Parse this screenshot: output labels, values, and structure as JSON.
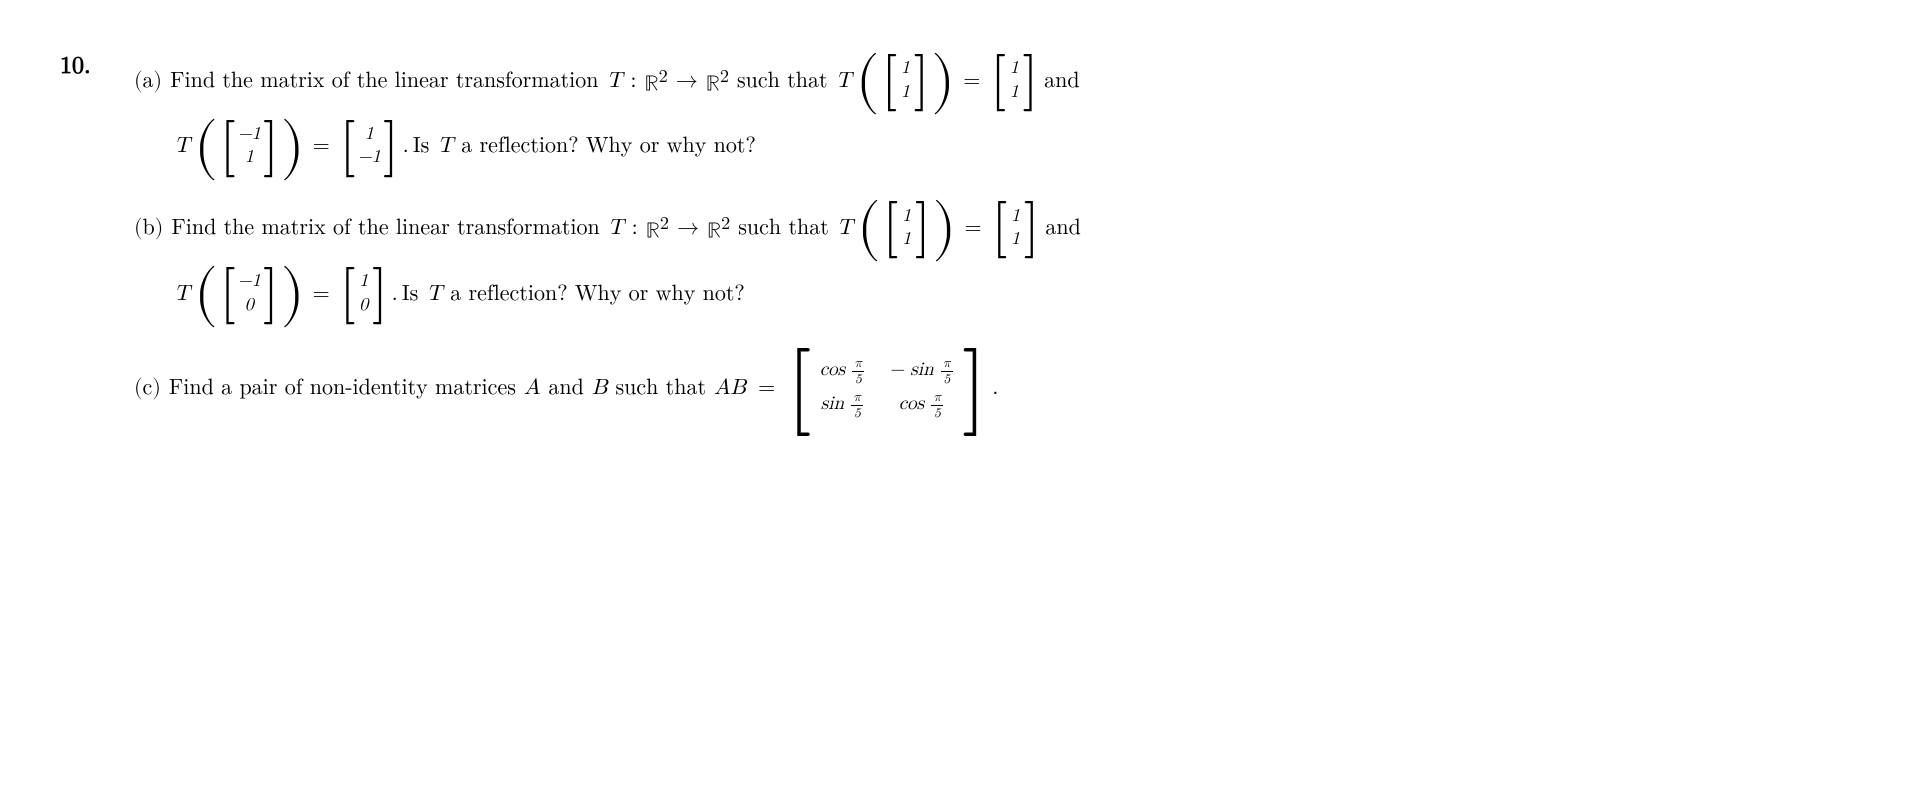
{
  "problem": {
    "number": "10.",
    "parts": {
      "a": {
        "label": "(a)",
        "text1": "Find the matrix of the linear transformation",
        "T": "T",
        "colon": ":",
        "R2": "ℝ",
        "sup1": "2",
        "arrow": "→",
        "R2b": "ℝ",
        "sup2": "2",
        "text2": "such that",
        "T2": "T",
        "input_vec1_top": "1",
        "input_vec1_bot": "1",
        "equals": "=",
        "output_vec1_top": "1",
        "output_vec1_bot": "1",
        "and": "and",
        "T3": "T",
        "input_vec2_top": "−1",
        "input_vec2_bot": "1",
        "equals2": "=",
        "output_vec2_top": "1",
        "output_vec2_bot": "−1",
        "period": ".",
        "question": "Is",
        "T4": "T",
        "question2": "a reflection? Why or why not?"
      },
      "b": {
        "label": "(b)",
        "text1": "Find the matrix of the linear transformation",
        "T": "T",
        "colon": ":",
        "R2": "ℝ",
        "sup1": "2",
        "arrow": "→",
        "R2b": "ℝ",
        "sup2": "2",
        "text2": "such that",
        "T2": "T",
        "input_vec1_top": "1",
        "input_vec1_bot": "1",
        "equals": "=",
        "output_vec1_top": "1",
        "output_vec1_bot": "1",
        "and": "and",
        "T3": "T",
        "input_vec2_top": "−1",
        "input_vec2_bot": "0",
        "equals2": "=",
        "output_vec2_top": "1",
        "output_vec2_bot": "0",
        "period": ".",
        "question": "Is",
        "T4": "T",
        "question2": "a reflection? Why or why not?"
      },
      "c": {
        "label": "(c)",
        "text1": "Find a pair of non-identity matrices",
        "A": "A",
        "and": "and",
        "B": "B",
        "text2": "such that",
        "AB": "AB",
        "equals": "=",
        "matrix_r1c1_trig": "cos",
        "matrix_r1c1_frac_num": "π",
        "matrix_r1c1_frac_den": "5",
        "matrix_r1c2_neg": "−",
        "matrix_r1c2_trig": "sin",
        "matrix_r1c2_frac_num": "π",
        "matrix_r1c2_frac_den": "5",
        "matrix_r2c1_trig": "sin",
        "matrix_r2c1_frac_num": "π",
        "matrix_r2c1_frac_den": "5",
        "matrix_r2c2_trig": "cos",
        "matrix_r2c2_frac_num": "π",
        "matrix_r2c2_frac_den": "5",
        "period": "."
      }
    }
  }
}
